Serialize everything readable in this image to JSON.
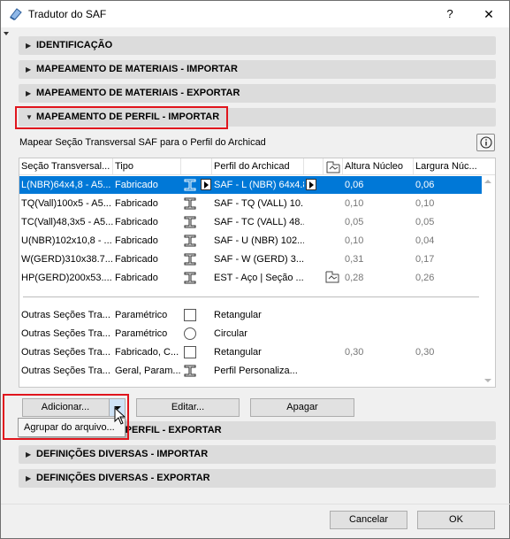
{
  "window": {
    "title": "Tradutor do SAF",
    "help_label": "?",
    "close_label": "✕"
  },
  "sections": [
    {
      "label": "IDENTIFICAÇÃO",
      "expanded": false
    },
    {
      "label": "MAPEAMENTO DE MATERIAIS - IMPORTAR",
      "expanded": false
    },
    {
      "label": "MAPEAMENTO DE MATERIAIS - EXPORTAR",
      "expanded": false
    },
    {
      "label": "MAPEAMENTO DE PERFIL - IMPORTAR",
      "expanded": true
    },
    {
      "label": "MAPEAMENTO DE PERFIL - EXPORTAR",
      "expanded": false
    },
    {
      "label": "DEFINIÇÕES DIVERSAS - IMPORTAR",
      "expanded": false
    },
    {
      "label": "DEFINIÇÕES DIVERSAS - EXPORTAR",
      "expanded": false
    }
  ],
  "profile_import": {
    "description": "Mapear Seção Transversal SAF para o Perfil do Archicad",
    "columns": [
      "Seção Transversal...",
      "Tipo",
      "Perfil do Archicad",
      "Altura Núcleo",
      "Largura Núc..."
    ],
    "rows": [
      {
        "section": "L(NBR)64x4,8 - A5...",
        "type": "Fabricado",
        "profile": "SAF - L (NBR) 64x4.8",
        "height": "0,06",
        "width": "0,06",
        "icon": "i-beam-icon",
        "selected": true
      },
      {
        "section": "TQ(Vall)100x5 - A5...",
        "type": "Fabricado",
        "profile": "SAF - TQ (VALL) 10...",
        "height": "0,10",
        "width": "0,10",
        "icon": "i-beam-icon",
        "selected": false
      },
      {
        "section": "TC(Vall)48,3x5 - A5...",
        "type": "Fabricado",
        "profile": "SAF - TC (VALL) 48....",
        "height": "0,05",
        "width": "0,05",
        "icon": "i-beam-icon",
        "selected": false
      },
      {
        "section": "U(NBR)102x10,8 - ...",
        "type": "Fabricado",
        "profile": "SAF - U (NBR) 102...",
        "height": "0,10",
        "width": "0,04",
        "icon": "i-beam-icon",
        "selected": false
      },
      {
        "section": "W(GERD)310x38.7...",
        "type": "Fabricado",
        "profile": "SAF - W (GERD) 3...",
        "height": "0,31",
        "width": "0,17",
        "icon": "i-beam-icon",
        "selected": false
      },
      {
        "section": "HP(GERD)200x53....",
        "type": "Fabricado",
        "profile": "EST - Aço | Seção ...",
        "height": "0,28",
        "width": "0,26",
        "icon": "i-beam-icon",
        "selected": false
      }
    ],
    "other_rows": [
      {
        "section": "Outras Seções Tra...",
        "type": "Paramétrico",
        "profile": "Retangular",
        "height": "",
        "width": "",
        "icon": "square-icon"
      },
      {
        "section": "Outras Seções Tra...",
        "type": "Paramétrico",
        "profile": "Circular",
        "height": "",
        "width": "",
        "icon": "circle-icon"
      },
      {
        "section": "Outras Seções Tra...",
        "type": "Fabricado, C...",
        "profile": "Retangular",
        "height": "0,30",
        "width": "0,30",
        "icon": "square-icon"
      },
      {
        "section": "Outras Seções Tra...",
        "type": "Geral, Param...",
        "profile": "Perfil Personaliza...",
        "height": "",
        "width": "",
        "icon": "i-beam-icon"
      }
    ]
  },
  "buttons": {
    "add": "Adicionar...",
    "edit": "Editar...",
    "delete": "Apagar",
    "cancel": "Cancelar",
    "ok": "OK"
  },
  "add_menu": {
    "item": "Agrupar do arquivo..."
  }
}
